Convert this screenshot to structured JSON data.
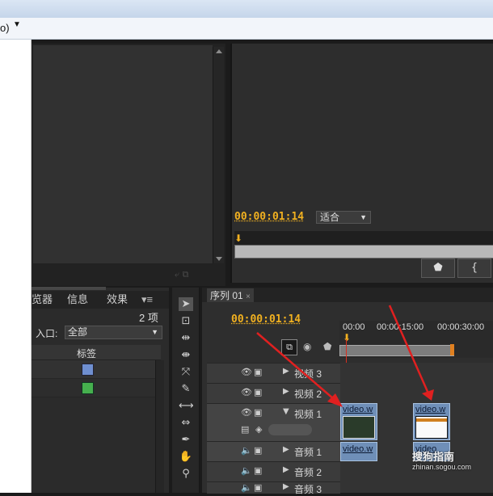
{
  "menubar": {
    "text": "o)",
    "caret": "▼"
  },
  "program": {
    "timecode": "00:00:01:14",
    "fit_value": "适合",
    "buttons": [
      "⬟",
      "{"
    ]
  },
  "project": {
    "tabs": [
      "览器",
      "信息",
      "效果"
    ],
    "item_count": "2 项",
    "in_label": "入口:",
    "in_value": "全部",
    "col_label": "标签",
    "label_colors": [
      "#6f8fd0",
      "#46b04e"
    ]
  },
  "sequence": {
    "tab": "序列 01",
    "timecode": "00:00:01:14",
    "ruler_ticks": [
      "00:00",
      "00:00:15:00",
      "00:00:30:00"
    ],
    "tracks": [
      {
        "name": "视频 3",
        "type": "video"
      },
      {
        "name": "视频 2",
        "type": "video"
      },
      {
        "name": "视频 1",
        "type": "video"
      },
      {
        "name": "音频 1",
        "type": "audio"
      },
      {
        "name": "音频 2",
        "type": "audio"
      },
      {
        "name": "音频 3",
        "type": "audio"
      }
    ],
    "clips": {
      "video_a": "video.w",
      "video_b": "video.w",
      "audio_a": "video.w",
      "audio_b": "video"
    }
  },
  "watermark": {
    "brand": "搜狗指南",
    "url": "zhinan.sogou.com"
  },
  "colors": {
    "accent_timecode": "#f0b020",
    "arrow": "#e02020",
    "playhead": "#d83020"
  }
}
